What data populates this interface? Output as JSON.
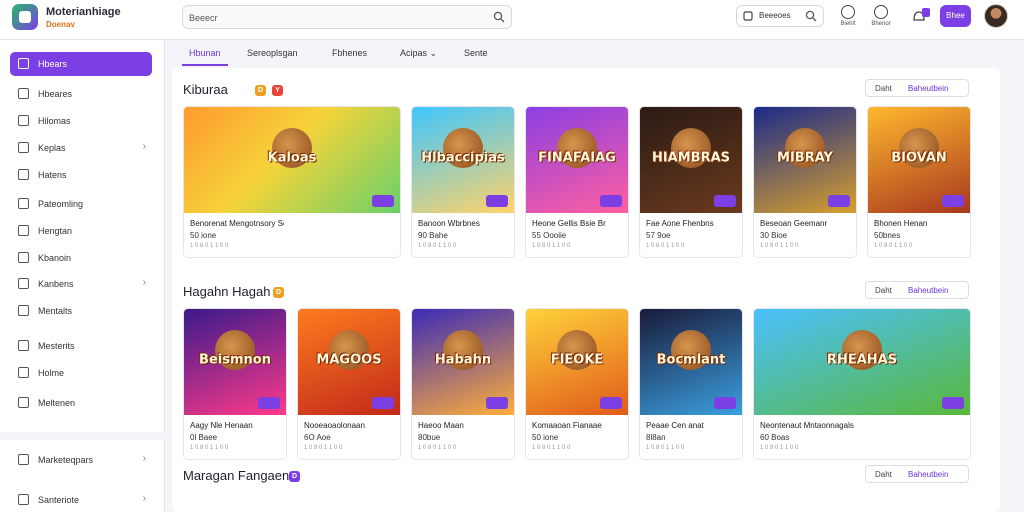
{
  "app": {
    "title": "Moterianhiage",
    "subtitle": "Doenav"
  },
  "search": {
    "value": "Beeecr"
  },
  "search2": {
    "label": "Beeeoes"
  },
  "topbar_icons": [
    {
      "name": "timer-icon",
      "label": "Biehlt"
    },
    {
      "name": "bell-icon",
      "label": "Bhenor"
    },
    {
      "name": "notifications-icon",
      "label": ""
    }
  ],
  "topbar_button": {
    "label": "Bhee"
  },
  "sidebar": {
    "items": [
      {
        "label": "Hbears",
        "icon": "home-icon",
        "active": true,
        "chevron": false
      },
      {
        "label": "Hbeares",
        "icon": "list-icon",
        "active": false,
        "chevron": false
      },
      {
        "label": "Hilomas",
        "icon": "chart-icon",
        "active": false,
        "chevron": false
      },
      {
        "label": "Keplas",
        "icon": "grid-icon",
        "active": false,
        "chevron": true
      },
      {
        "label": "Hatens",
        "icon": "folder-icon",
        "active": false,
        "chevron": false
      },
      {
        "label": "Pateomling",
        "icon": "gear-icon",
        "active": false,
        "chevron": false
      },
      {
        "label": "Hengtan",
        "icon": "clock-icon",
        "active": false,
        "chevron": false
      },
      {
        "label": "Kbanoin",
        "icon": "tag-icon",
        "active": false,
        "chevron": false
      },
      {
        "label": "Kanbens",
        "icon": "edit-icon",
        "active": false,
        "chevron": true
      },
      {
        "label": "Mentalts",
        "icon": "document-icon",
        "active": false,
        "chevron": false
      },
      {
        "label": "Mesterits",
        "icon": "bar-chart-icon",
        "active": false,
        "chevron": false
      },
      {
        "label": "Holme",
        "icon": "house-icon",
        "active": false,
        "chevron": false
      },
      {
        "label": "Meltenen",
        "icon": "settings-icon",
        "active": false,
        "chevron": false
      }
    ],
    "bottom_items": [
      {
        "label": "Marketeqpars",
        "icon": "marketplace-icon",
        "chevron": true
      },
      {
        "label": "Santeriote",
        "icon": "settings-icon",
        "chevron": true
      }
    ]
  },
  "tabs": [
    {
      "label": "Hbunan",
      "active": true
    },
    {
      "label": "Sereoplsgan",
      "active": false
    },
    {
      "label": "Fbhenes",
      "active": false
    },
    {
      "label": "Acipas ⌄",
      "active": false
    },
    {
      "label": "Sente",
      "active": false
    }
  ],
  "sections": [
    {
      "title": "Kiburaa",
      "badges": [
        "D",
        "Y"
      ],
      "buttons": {
        "b1": "Daht",
        "b2": "Baheutbein"
      },
      "cards": [
        {
          "art": "Kaloas",
          "name": "Benorenat Mengotnsory Soriiltte",
          "sub": "50 ione",
          "sub2": "1 0 8 0 1 1 0 0",
          "bg": "linear-gradient(135deg,#ff9a2e,#f5d33a 45%,#6ad06a)",
          "wide": true
        },
        {
          "art": "Hlbaccipias",
          "name": "Banoon Wbrbnes",
          "sub": "90 Bahe",
          "sub2": "1 0 8 0 1 1 0 0",
          "bg": "linear-gradient(160deg,#3fc6ff,#ffd36a)"
        },
        {
          "art": "FINAFAIAG",
          "name": "Heone Gellis Bsie Br",
          "sub": "55 Oooiie",
          "sub2": "1 0 8 0 1 1 0 0",
          "bg": "linear-gradient(160deg,#8b3fe4,#ff5fa0)"
        },
        {
          "art": "HIAMBRAS",
          "name": "Fae Aone Fhenbns",
          "sub": "57 9oe",
          "sub2": "1 0 8 0 1 1 0 0",
          "bg": "linear-gradient(160deg,#2b1a14,#6a3a1e)"
        },
        {
          "art": "MIBRAY",
          "name": "Beseoan Geemanr",
          "sub": "30 Bioe",
          "sub2": "1 0 8 0 1 1 0 0",
          "bg": "linear-gradient(160deg,#1a2a8a,#d8a02e)"
        },
        {
          "art": "BIOVAN",
          "name": "Bhonen Henan",
          "sub": "50bnes",
          "sub2": "1 0 8 0 1 1 0 0",
          "bg": "linear-gradient(160deg,#ffb82e,#a8381e)"
        }
      ]
    },
    {
      "title": "Hagahn Hagah",
      "badges": [
        "D"
      ],
      "buttons": {
        "b1": "Daht",
        "b2": "Baheutbein"
      },
      "cards": [
        {
          "art": "Beismnon",
          "name": "Aagy Nle Henaan",
          "sub": "0l Baee",
          "sub2": "1 0 8 0 1 1 0 0",
          "bg": "linear-gradient(160deg,#3a1a8a,#ff3a8a)"
        },
        {
          "art": "MAGOOS",
          "name": "Nooeaoaolonaan",
          "sub": "6O Aoe",
          "sub2": "1 0 8 0 1 1 0 0",
          "bg": "linear-gradient(160deg,#ff7a1e,#c02a1a)"
        },
        {
          "art": "Habahn",
          "name": "Haeoo Maan",
          "sub": "80bue",
          "sub2": "1 0 8 0 1 1 0 0",
          "bg": "linear-gradient(160deg,#3a2ab8,#ffae3a)"
        },
        {
          "art": "FIEOKE",
          "name": "Komaaoan Fianaae",
          "sub": "50 ione",
          "sub2": "1 0 8 0 1 1 0 0",
          "bg": "linear-gradient(160deg,#ffd23a,#e05a1a)"
        },
        {
          "art": "Bocmlant",
          "name": "Peaae Cen anat",
          "sub": "8l8an",
          "sub2": "1 0 8 0 1 1 0 0",
          "bg": "linear-gradient(160deg,#1a1a3a,#3aa0e0)"
        },
        {
          "art": "RHEAHAS",
          "name": "Neontenaut Mntaonnagals Gantaran Geeman",
          "sub": "60 Boas",
          "sub2": "1 0 8 0 1 1 0 0",
          "bg": "linear-gradient(160deg,#4ac0ff,#5ab83a)",
          "wide": true
        }
      ]
    },
    {
      "title": "Maragan Fangaen",
      "badges": [
        "D"
      ],
      "buttons": {
        "b1": "Daht",
        "b2": "Baheutbein"
      },
      "cards": []
    }
  ],
  "colors": {
    "accent": "#7b3fe4",
    "brand_green": "#28b86b",
    "badge_orange": "#f0a020",
    "badge_red": "#e8453a"
  }
}
